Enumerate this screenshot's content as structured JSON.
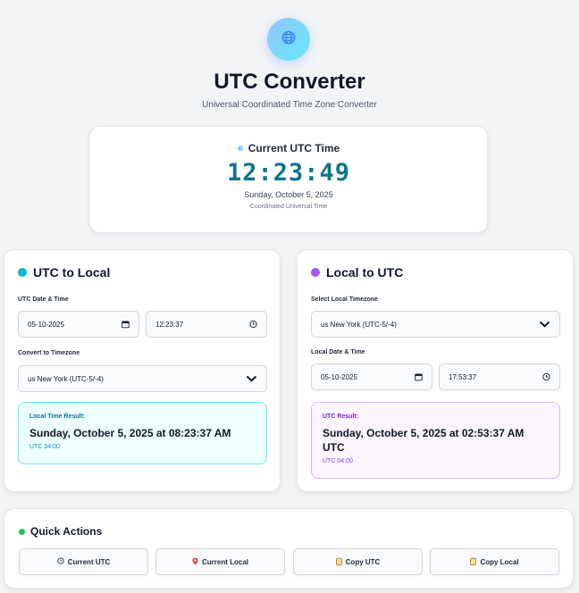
{
  "app": {
    "title": "UTC Converter",
    "subtitle": "Universal Coordinated Time Zone Converter",
    "logo_icon": "globe-icon"
  },
  "clock": {
    "label": "Current UTC Time",
    "time": "12:23:49",
    "date": "Sunday, October 5, 2025",
    "caption": "Coordinated Universal Time",
    "dot_color": "#7dd3fc"
  },
  "utc_to_local": {
    "title": "UTC to Local",
    "accent": "#06b6d4",
    "datetime_label": "UTC Date & Time",
    "date_value": "05-10-2025",
    "time_value": "12:23:37",
    "timezone_label": "Convert to Timezone",
    "timezone_value": "us New York (UTC-5/-4)",
    "result_label": "Local Time Result:",
    "result_value": "Sunday, October 5, 2025 at 08:23:37 AM",
    "result_offset": "UTC 04:00"
  },
  "local_to_utc": {
    "title": "Local to UTC",
    "accent": "#a855f7",
    "timezone_label": "Select Local Timezone",
    "timezone_value": "us New York (UTC-5/-4)",
    "datetime_label": "Local Date & Time",
    "date_value": "05-10-2025",
    "time_value": "17:53:37",
    "result_label": "UTC Result:",
    "result_value": "Sunday, October 5, 2025 at 02:53:37 AM UTC",
    "result_offset": "UTC 04:00"
  },
  "quick_actions": {
    "title": "Quick Actions",
    "accent": "#22c55e",
    "buttons": [
      {
        "label": "Current UTC",
        "icon": "clock-icon"
      },
      {
        "label": "Current Local",
        "icon": "pin-icon"
      },
      {
        "label": "Copy UTC",
        "icon": "clipboard-icon"
      },
      {
        "label": "Copy Local",
        "icon": "clipboard-icon"
      }
    ]
  }
}
